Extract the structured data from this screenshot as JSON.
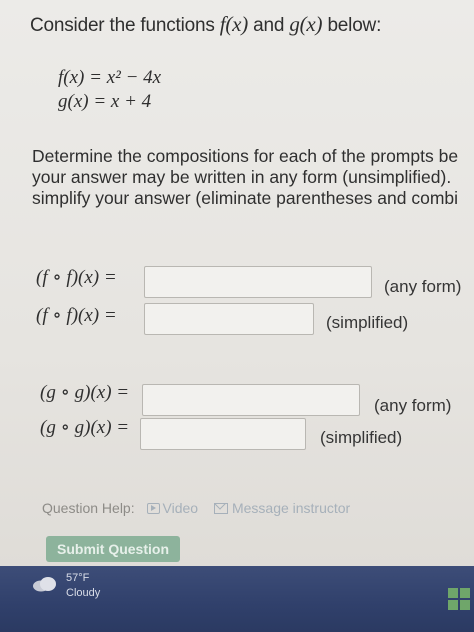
{
  "question": {
    "intro_prefix": "Consider the functions ",
    "f": "f(x)",
    "and": " and ",
    "g": "g(x)",
    "intro_suffix": " below:",
    "f_def": "f(x) = x² − 4x",
    "g_def": "g(x) = x + 4",
    "prompt_line1": "Determine the compositions for each of the prompts be",
    "prompt_line2": "your answer may be written in any form (unsimplified).",
    "prompt_line3": "simplify your answer (eliminate parentheses and combi"
  },
  "rows": [
    {
      "label": "(f ∘ f)(x) =",
      "value": "",
      "hint": "(any form)"
    },
    {
      "label": "(f ∘ f)(x) =",
      "value": "",
      "hint": "(simplified)"
    },
    {
      "label": "(g ∘ g)(x) =",
      "value": "",
      "hint": "(any form)"
    },
    {
      "label": "(g ∘ g)(x) =",
      "value": "",
      "hint": "(simplified)"
    }
  ],
  "help": {
    "label": "Question Help:",
    "video": "Video",
    "message": "Message instructor"
  },
  "submit_label": "Submit Question",
  "weather": {
    "temp": "57°F",
    "desc": "Cloudy",
    "icon": "cloud-icon"
  },
  "colors": {
    "submit": "#8db39c",
    "taskbar": "#30406b",
    "start": "#6fa66a"
  }
}
